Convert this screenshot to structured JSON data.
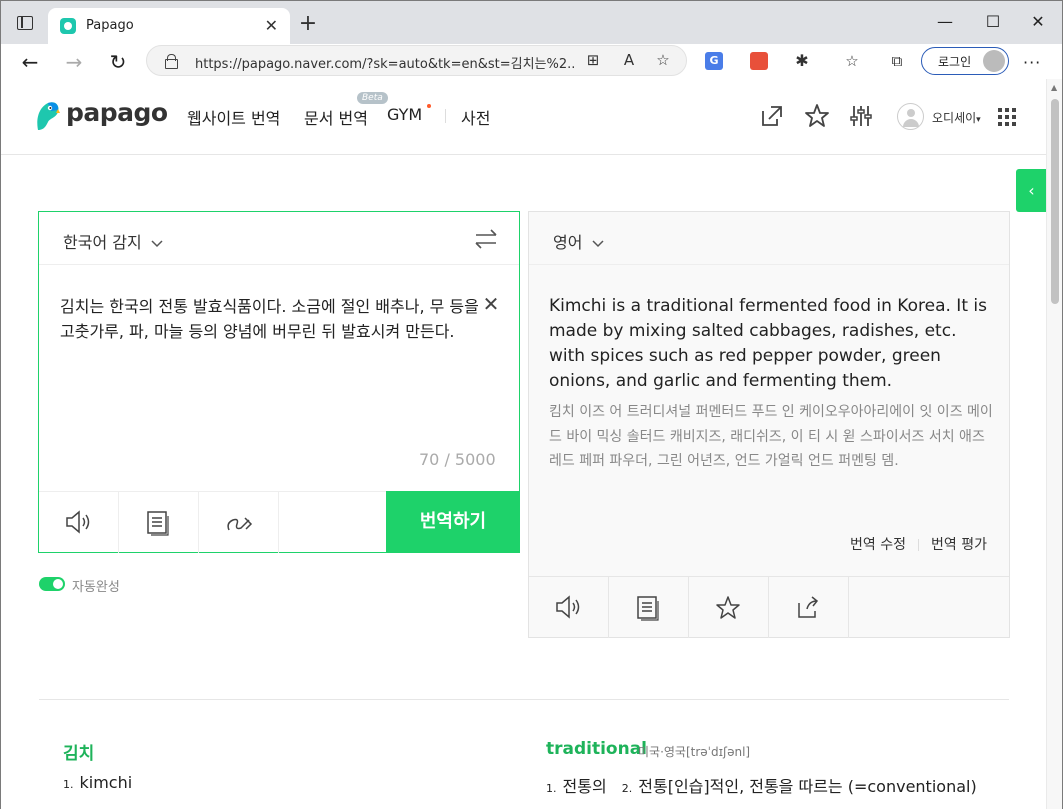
{
  "browser": {
    "tab_title": "Papago",
    "tab_close": "✕",
    "new_tab": "+",
    "url": "https://papago.naver.com/?sk=auto&tk=en&st=김치는%2...",
    "login_label": "로그인",
    "more": "···",
    "window_controls": {
      "minimize": "—",
      "maximize": "☐",
      "close": "✕"
    },
    "nav": {
      "back": "←",
      "forward": "→",
      "refresh": "↻"
    }
  },
  "header": {
    "logo": "papago",
    "nav": [
      "웹사이트 번역",
      "문서 번역",
      "GYM",
      "사전"
    ],
    "beta": "Beta",
    "user_name": "오디세이",
    "user_caret": "▾"
  },
  "side_tab": "‹",
  "source": {
    "language": "한국어 감지",
    "text": "김치는 한국의 전통 발효식품이다. 소금에 절인 배추나, 무 등을 고춧가루, 파, 마늘 등의 양념에 버무린 뒤 발효시켜 만든다.",
    "clear": "✕",
    "char_count": "70 / 5000",
    "translate_button": "번역하기",
    "autocomplete_label": "자동완성"
  },
  "target": {
    "language": "영어",
    "text": "Kimchi is a traditional fermented food in Korea. It is made by mixing salted cabbages, radishes, etc. with spices such as red pepper powder, green onions, and garlic and fermenting them.",
    "pronunciation": "킴치 이즈 어 트러디셔널 퍼멘터드 푸드 인 케이오우아아리에이 잇 이즈 메이드 바이 믹싱 솔터드 캐비지즈, 래디쉬즈, 이 티 시 윋 스파이서즈 서치 애즈 레드 페퍼 파우더, 그린 어년즈, 언드 가얼릭 언드 퍼멘팅 뎀.",
    "edit_translation": "번역 수정",
    "rate_translation": "번역 평가"
  },
  "dictionary": {
    "left": {
      "word": "김치",
      "defs": [
        {
          "num": "1.",
          "text": "kimchi"
        }
      ]
    },
    "right": {
      "word": "traditional",
      "phonetic": "미국·영국[trəˈdɪʃənl]",
      "defs": [
        {
          "num": "1.",
          "text": "전통의"
        },
        {
          "num": "2.",
          "text": "전통[인습]적인, 전통을 따르는 (=conventional)"
        }
      ]
    }
  },
  "colors": {
    "accent": "#1ed26a",
    "dict_word": "#1eb35a"
  }
}
